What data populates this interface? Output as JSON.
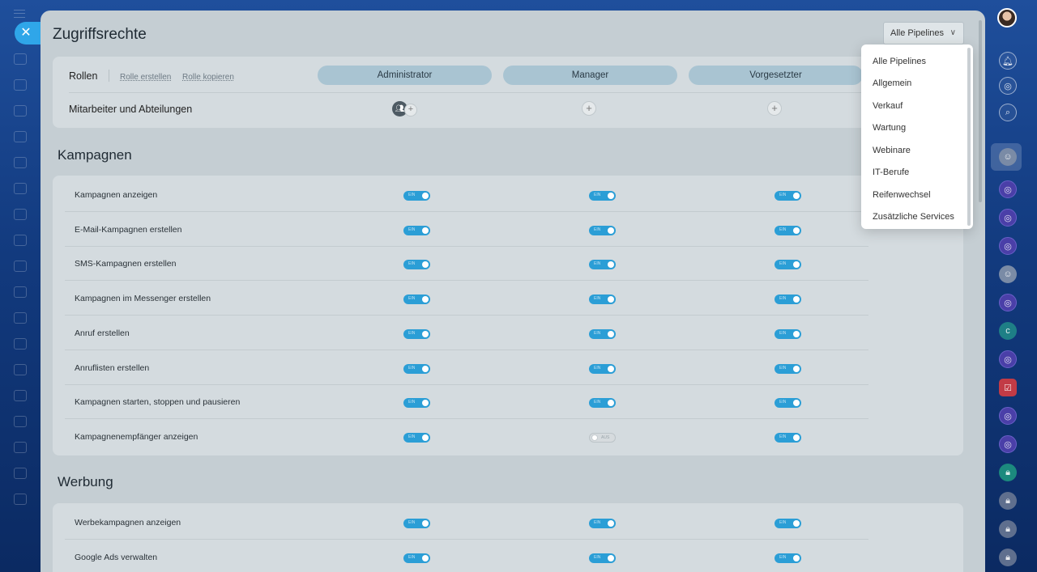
{
  "page": {
    "title": "Zugriffsrechte"
  },
  "pipelines": {
    "button_label": "Alle Pipelines",
    "options": [
      "Alle Pipelines",
      "Allgemein",
      "Verkauf",
      "Wartung",
      "Webinare",
      "IT-Berufe",
      "Reifenwechsel",
      "Zusätzliche Services"
    ]
  },
  "roles": {
    "label": "Rollen",
    "create_link": "Rolle erstellen",
    "copy_link": "Rolle kopieren",
    "items": [
      "Administrator",
      "Manager",
      "Vorgesetzter"
    ],
    "employees_label": "Mitarbeiter und Abteilungen"
  },
  "toggle_text": {
    "on": "EIN",
    "off": "AUS"
  },
  "sections": [
    {
      "title": "Kampagnen",
      "rows": [
        {
          "label": "Kampagnen anzeigen",
          "values": [
            true,
            true,
            true
          ]
        },
        {
          "label": "E-Mail-Kampagnen erstellen",
          "values": [
            true,
            true,
            true
          ]
        },
        {
          "label": "SMS-Kampagnen erstellen",
          "values": [
            true,
            true,
            true
          ]
        },
        {
          "label": "Kampagnen im Messenger erstellen",
          "values": [
            true,
            true,
            true
          ]
        },
        {
          "label": "Anruf erstellen",
          "values": [
            true,
            true,
            true
          ]
        },
        {
          "label": "Anruflisten erstellen",
          "values": [
            true,
            true,
            true
          ]
        },
        {
          "label": "Kampagnen starten, stoppen und pausieren",
          "values": [
            true,
            true,
            true
          ]
        },
        {
          "label": "Kampagnenempfänger anzeigen",
          "values": [
            true,
            false,
            true
          ]
        }
      ]
    },
    {
      "title": "Werbung",
      "rows": [
        {
          "label": "Werbekampagnen anzeigen",
          "values": [
            true,
            true,
            true
          ]
        },
        {
          "label": "Google Ads verwalten",
          "values": [
            true,
            true,
            true
          ]
        }
      ]
    }
  ],
  "colors": {
    "accent": "#2fa6e9",
    "toggle_on": "#2b9ed6",
    "role_pill": "#a9c4d2"
  }
}
